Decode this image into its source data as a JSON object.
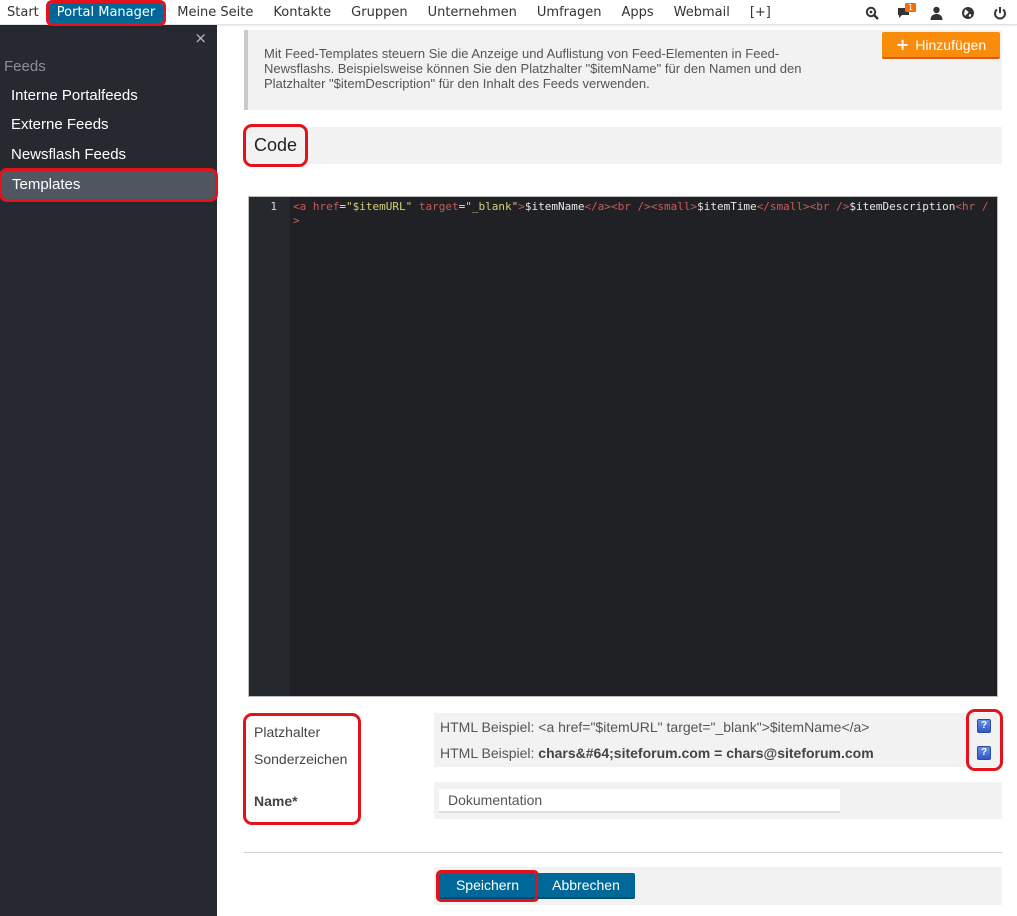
{
  "topnav": {
    "items": [
      {
        "label": "Start"
      },
      {
        "label": "Portal Manager",
        "active": true
      },
      {
        "label": "Meine Seite"
      },
      {
        "label": "Kontakte"
      },
      {
        "label": "Gruppen"
      },
      {
        "label": "Unternehmen"
      },
      {
        "label": "Umfragen"
      },
      {
        "label": "Apps"
      },
      {
        "label": "Webmail"
      },
      {
        "label": "[+]"
      }
    ],
    "icons": [
      {
        "name": "search-icon"
      },
      {
        "name": "messages-icon",
        "badge": "1"
      },
      {
        "name": "user-icon"
      },
      {
        "name": "globe-icon"
      },
      {
        "name": "power-icon"
      }
    ],
    "active_color": "#006898"
  },
  "sidebar": {
    "close_label": "×",
    "section_title": "Feeds",
    "items": [
      {
        "label": "Interne Portalfeeds"
      },
      {
        "label": "Externe Feeds"
      },
      {
        "label": "Newsflash Feeds"
      },
      {
        "label": "Templates",
        "selected": true
      }
    ]
  },
  "info": {
    "text": "Mit Feed-Templates steuern Sie die Anzeige und Auflistung von Feed-Elementen in Feed-Newsflashs. Beispielsweise können Sie den Platzhalter \"$itemName\" für den Namen und den Platzhalter \"$itemDescription\" für den Inhalt des Feeds verwenden.",
    "add_button": "Hinzufügen",
    "add_color": "#f98c0b"
  },
  "code_section": {
    "title": "Code",
    "line_number": "1",
    "code": "<a href=\"$itemURL\" target=\"_blank\">$itemName</a><br /><small>$itemTime</small><br />$itemDescription<hr />"
  },
  "form": {
    "placeholder_label": "Platzhalter",
    "special_chars_label": "Sonderzeichen",
    "name_label": "Name*",
    "placeholder_example_prefix": "HTML Beispiel: ",
    "placeholder_example": "<a href=\"$itemURL\" target=\"_blank\">$itemName</a>",
    "special_example_prefix": "HTML Beispiel: ",
    "special_example": "chars&#64;siteforum.com = chars@siteforum.com",
    "help_label": "?",
    "name_value": "Dokumentation"
  },
  "actions": {
    "save": "Speichern",
    "cancel": "Abbrechen"
  }
}
